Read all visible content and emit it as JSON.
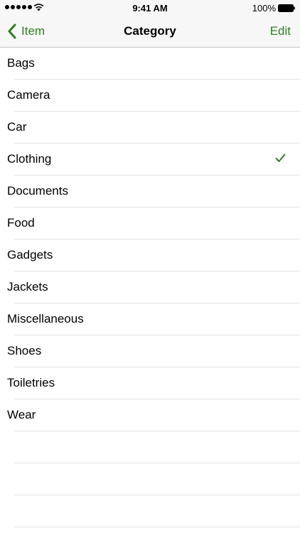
{
  "status_bar": {
    "time": "9:41 AM",
    "battery_percent": "100%",
    "signal_icon": "signal-dots-icon",
    "wifi_icon": "wifi-icon",
    "battery_icon": "battery-icon"
  },
  "nav": {
    "back_label": "Item",
    "title": "Category",
    "edit_label": "Edit",
    "accent_color": "#2e7d1f"
  },
  "categories": [
    {
      "label": "Bags",
      "selected": false
    },
    {
      "label": "Camera",
      "selected": false
    },
    {
      "label": "Car",
      "selected": false
    },
    {
      "label": "Clothing",
      "selected": true
    },
    {
      "label": "Documents",
      "selected": false
    },
    {
      "label": "Food",
      "selected": false
    },
    {
      "label": "Gadgets",
      "selected": false
    },
    {
      "label": "Jackets",
      "selected": false
    },
    {
      "label": "Miscellaneous",
      "selected": false
    },
    {
      "label": "Shoes",
      "selected": false
    },
    {
      "label": "Toiletries",
      "selected": false
    },
    {
      "label": "Wear",
      "selected": false
    }
  ]
}
